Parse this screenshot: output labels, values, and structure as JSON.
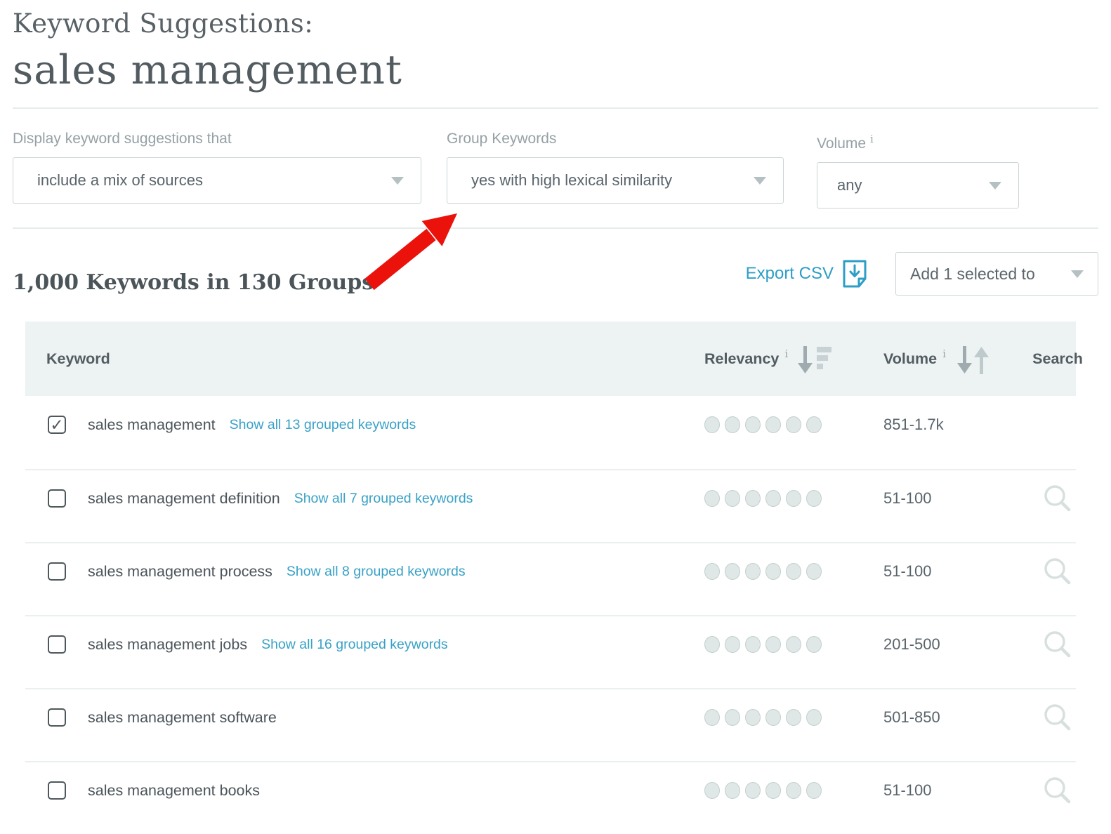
{
  "page": {
    "title_label": "Keyword Suggestions:",
    "query": "sales management"
  },
  "icons": {
    "info": "i",
    "check": "✓"
  },
  "filters": {
    "source": {
      "label": "Display keyword suggestions that",
      "value": "include a mix of sources"
    },
    "group": {
      "label": "Group Keywords",
      "value": "yes with high lexical similarity"
    },
    "volume": {
      "label": "Volume",
      "value": "any"
    }
  },
  "results": {
    "summary": "1,000 Keywords in 130 Groups",
    "export_label": "Export CSV",
    "add_selected_label": "Add 1 selected to"
  },
  "table": {
    "headers": {
      "keyword": "Keyword",
      "relevancy": "Relevancy",
      "volume": "Volume",
      "search": "Search"
    },
    "relevancy_dots": 6,
    "rows": [
      {
        "keyword": "sales management",
        "link": "Show all 13 grouped keywords",
        "volume": "851-1.7k",
        "checked": true,
        "search": false
      },
      {
        "keyword": "sales management definition",
        "link": "Show all 7 grouped keywords",
        "volume": "51-100",
        "checked": false,
        "search": true
      },
      {
        "keyword": "sales management process",
        "link": "Show all 8 grouped keywords",
        "volume": "51-100",
        "checked": false,
        "search": true
      },
      {
        "keyword": "sales management jobs",
        "link": "Show all 16 grouped keywords",
        "volume": "201-500",
        "checked": false,
        "search": true
      },
      {
        "keyword": "sales management software",
        "link": "",
        "volume": "501-850",
        "checked": false,
        "search": true
      },
      {
        "keyword": "sales management books",
        "link": "",
        "volume": "51-100",
        "checked": false,
        "search": true
      }
    ]
  },
  "colors": {
    "accent_blue": "#2d9ec6",
    "header_bg": "#ecf3f2",
    "arrow_red": "#ea120b"
  }
}
